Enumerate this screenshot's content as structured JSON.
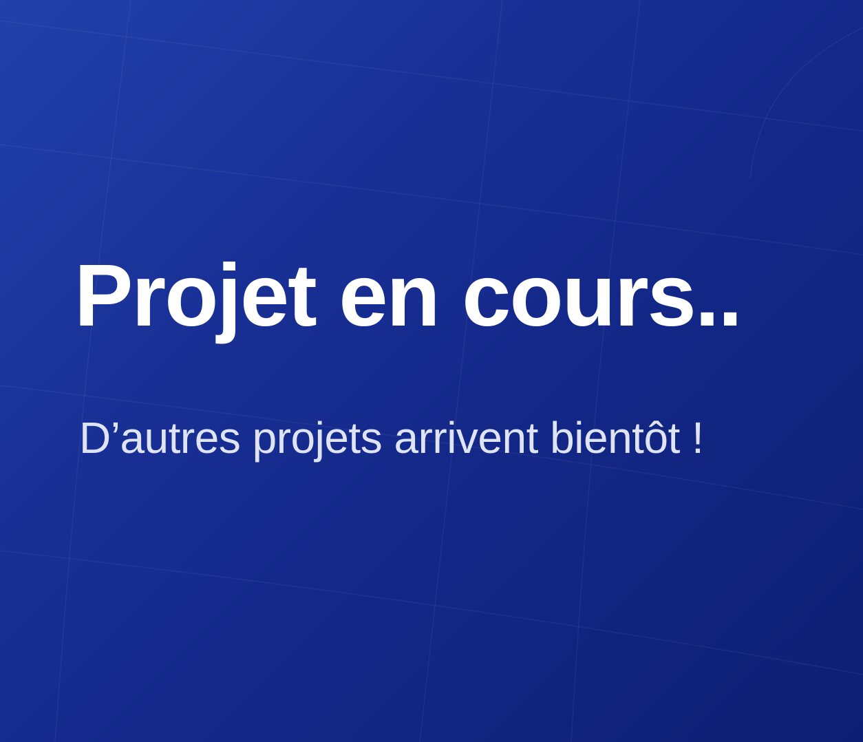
{
  "colors": {
    "background_start": "#2241ab",
    "background_end": "#0d1f72",
    "headline": "#ffffff",
    "subline": "#dfe4f4"
  },
  "headline": "Projet en cours..",
  "subline": "D’autres projets arrivent bientôt !"
}
